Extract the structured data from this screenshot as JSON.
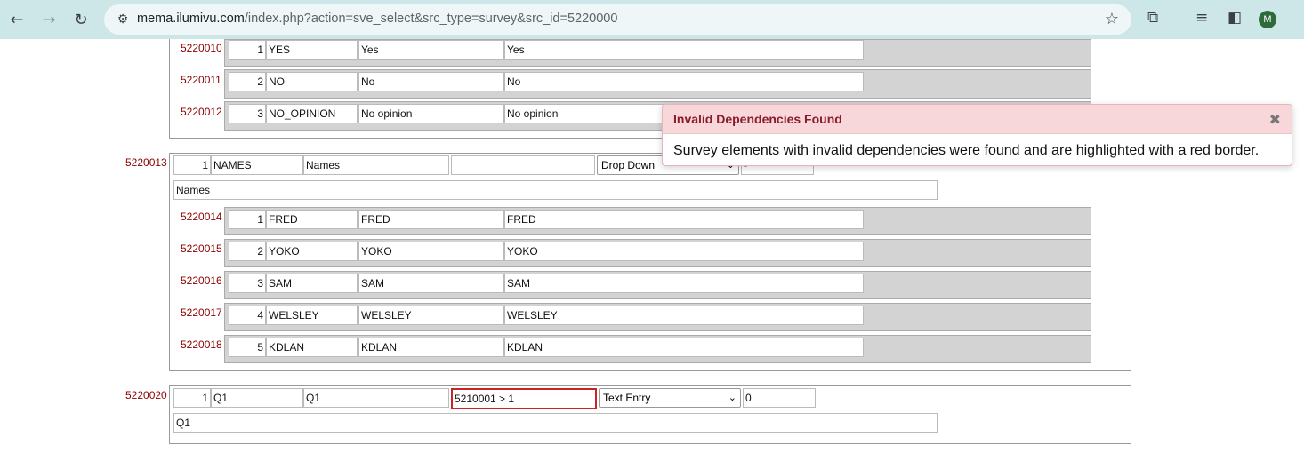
{
  "browser": {
    "url_host": "mema.ilumivu.com",
    "url_path": "/index.php?action=sve_select&src_type=survey&src_id=5220000",
    "profile_initial": "M"
  },
  "group_a": {
    "options": [
      {
        "id": "5220010",
        "order": "1",
        "code": "YES",
        "label": "Yes",
        "text": "Yes"
      },
      {
        "id": "5220011",
        "order": "2",
        "code": "NO",
        "label": "No",
        "text": "No"
      },
      {
        "id": "5220012",
        "order": "3",
        "code": "NO_OPINION",
        "label": "No opinion",
        "text": "No opinion"
      }
    ]
  },
  "question_names": {
    "id": "5220013",
    "order": "1",
    "code": "NAMES",
    "label": "Names",
    "dependency": "",
    "type": "Drop Down",
    "extra": "-",
    "prompt": "Names",
    "options": [
      {
        "id": "5220014",
        "order": "1",
        "code": "FRED",
        "label": "FRED",
        "text": "FRED"
      },
      {
        "id": "5220015",
        "order": "2",
        "code": "YOKO",
        "label": "YOKO",
        "text": "YOKO"
      },
      {
        "id": "5220016",
        "order": "3",
        "code": "SAM",
        "label": "SAM",
        "text": "SAM"
      },
      {
        "id": "5220017",
        "order": "4",
        "code": "WELSLEY",
        "label": "WELSLEY",
        "text": "WELSLEY"
      },
      {
        "id": "5220018",
        "order": "5",
        "code": "KDLAN",
        "label": "KDLAN",
        "text": "KDLAN"
      }
    ]
  },
  "question_q1": {
    "id": "5220020",
    "order": "1",
    "code": "Q1",
    "label": "Q1",
    "dependency": "5210001 > 1",
    "type": "Text Entry",
    "extra": "0",
    "prompt": "Q1"
  },
  "toast": {
    "title": "Invalid Dependencies Found",
    "close_glyph": "✖",
    "message": "Survey elements with invalid dependencies were found and are highlighted with a red border."
  }
}
